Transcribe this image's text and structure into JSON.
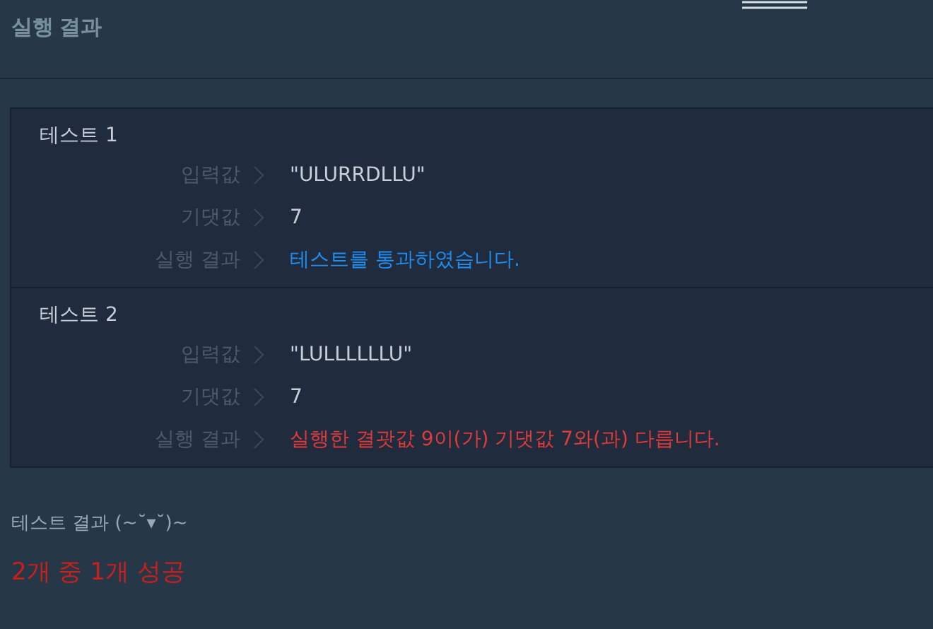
{
  "header": {
    "title": "실행 결과"
  },
  "tests": [
    {
      "title": "테스트 1",
      "rows": [
        {
          "label": "입력값",
          "value": "\"ULURRDLLU\""
        },
        {
          "label": "기댓값",
          "value": "7"
        }
      ],
      "result_label": "실행 결과",
      "result": {
        "text": "테스트를 통과하였습니다.",
        "color": "#1f8ef1"
      }
    },
    {
      "title": "테스트 2",
      "rows": [
        {
          "label": "입력값",
          "value": "\"LULLLLLLU\""
        },
        {
          "label": "기댓값",
          "value": "7"
        }
      ],
      "result_label": "실행 결과",
      "result": {
        "text": "실행한 결괏값 9이(가) 기댓값 7와(과) 다릅니다.",
        "color": "#e03a3a"
      }
    }
  ],
  "summary": {
    "label": "테스트 결과 (~˘▾˘)~",
    "text": "2개 중 1개 성공",
    "color": "#c8201f"
  }
}
